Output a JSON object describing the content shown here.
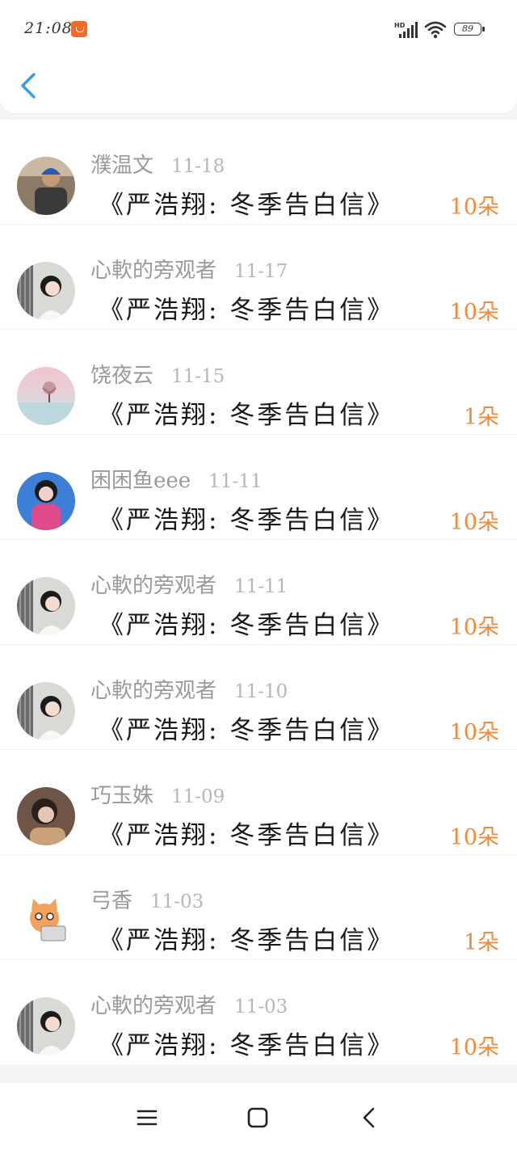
{
  "status_bar": {
    "time": "21:08",
    "battery": "89",
    "network": "HD"
  },
  "header": {
    "back_icon": "chevron-left-icon"
  },
  "colors": {
    "accent_blue": "#2f9df0",
    "count_orange": "#f08a3c",
    "name_gray": "#9a9a9a"
  },
  "items": [
    {
      "name": "濮温文",
      "date": "11-18",
      "title": "《严浩翔: 冬季告白信》",
      "count": "10朵",
      "avatar": "avatar-photo-man-blue-cap"
    },
    {
      "name": "心軟的旁观者",
      "date": "11-17",
      "title": "《严浩翔: 冬季告白信》",
      "count": "10朵",
      "avatar": "avatar-photo-girl"
    },
    {
      "name": "饶夜云",
      "date": "11-15",
      "title": "《严浩翔: 冬季告白信》",
      "count": "1朵",
      "avatar": "avatar-photo-pink-tree"
    },
    {
      "name": "困困鱼eee",
      "date": "11-11",
      "title": "《严浩翔: 冬季告白信》",
      "count": "10朵",
      "avatar": "avatar-photo-girl-pink-blue"
    },
    {
      "name": "心軟的旁观者",
      "date": "11-11",
      "title": "《严浩翔: 冬季告白信》",
      "count": "10朵",
      "avatar": "avatar-photo-girl"
    },
    {
      "name": "心軟的旁观者",
      "date": "11-10",
      "title": "《严浩翔: 冬季告白信》",
      "count": "10朵",
      "avatar": "avatar-photo-girl"
    },
    {
      "name": "巧玉姝",
      "date": "11-09",
      "title": "《严浩翔: 冬季告白信》",
      "count": "10朵",
      "avatar": "avatar-photo-woman-dark"
    },
    {
      "name": "弓香",
      "date": "11-03",
      "title": "《严浩翔: 冬季告白信》",
      "count": "1朵",
      "avatar": "avatar-cartoon-cat-laptop"
    },
    {
      "name": "心軟的旁观者",
      "date": "11-03",
      "title": "《严浩翔: 冬季告白信》",
      "count": "10朵",
      "avatar": "avatar-photo-girl"
    }
  ],
  "nav_bar": {
    "menu_icon": "menu-icon",
    "home_icon": "home-square-icon",
    "back_icon": "back-triangle-icon"
  }
}
